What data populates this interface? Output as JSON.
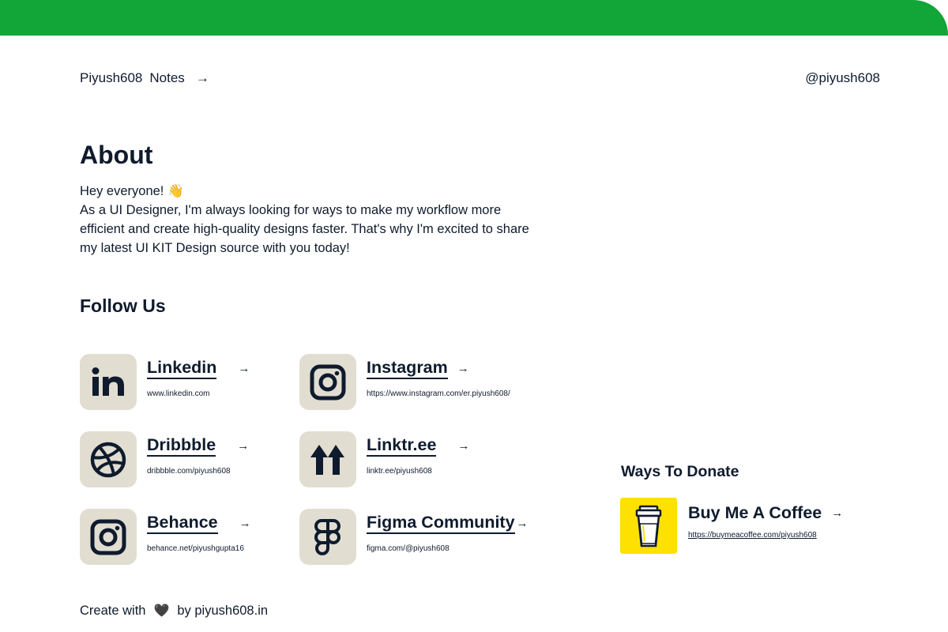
{
  "nav": {
    "brand": "Piyush608",
    "notes": "Notes",
    "arrow": "→",
    "handle": "@piyush608"
  },
  "about": {
    "title": "About",
    "greeting": "Hey everyone! 👋",
    "body": "As a UI Designer, I'm always looking for ways to make my workflow more efficient and create high-quality designs faster. That's why I'm excited to share my latest UI KIT Design source with you today!"
  },
  "follow": {
    "title": "Follow Us",
    "links": [
      {
        "title": "Linkedin",
        "url": "www.linkedin.com",
        "icon": "linkedin-icon"
      },
      {
        "title": "Instagram",
        "url": "https://www.instagram.com/er.piyush608/",
        "icon": "instagram-icon"
      },
      {
        "title": "Dribbble",
        "url": "dribbble.com/piyush608",
        "icon": "dribbble-icon"
      },
      {
        "title": "Linktr.ee",
        "url": "linktr.ee/piyush608",
        "icon": "linktree-icon"
      },
      {
        "title": "Behance",
        "url": "behance.net/piyushgupta16",
        "icon": "instagram-icon"
      },
      {
        "title": "Figma Community",
        "url": "figma.com/@piyush608",
        "icon": "figma-icon"
      }
    ],
    "arrow": "→"
  },
  "donate": {
    "title": "Ways To Donate",
    "name": "Buy Me A Coffee",
    "url": "https://buymeacoffee.com/piyush608",
    "arrow": "→"
  },
  "footer": {
    "prefix": "Create with",
    "heart": "🖤",
    "suffix": "by piyush608.in"
  },
  "colors": {
    "accent_green": "#12a538",
    "icon_tile": "#e1ddd1",
    "coffee_yellow": "#ffe100",
    "text_dark": "#0f1b2d"
  }
}
